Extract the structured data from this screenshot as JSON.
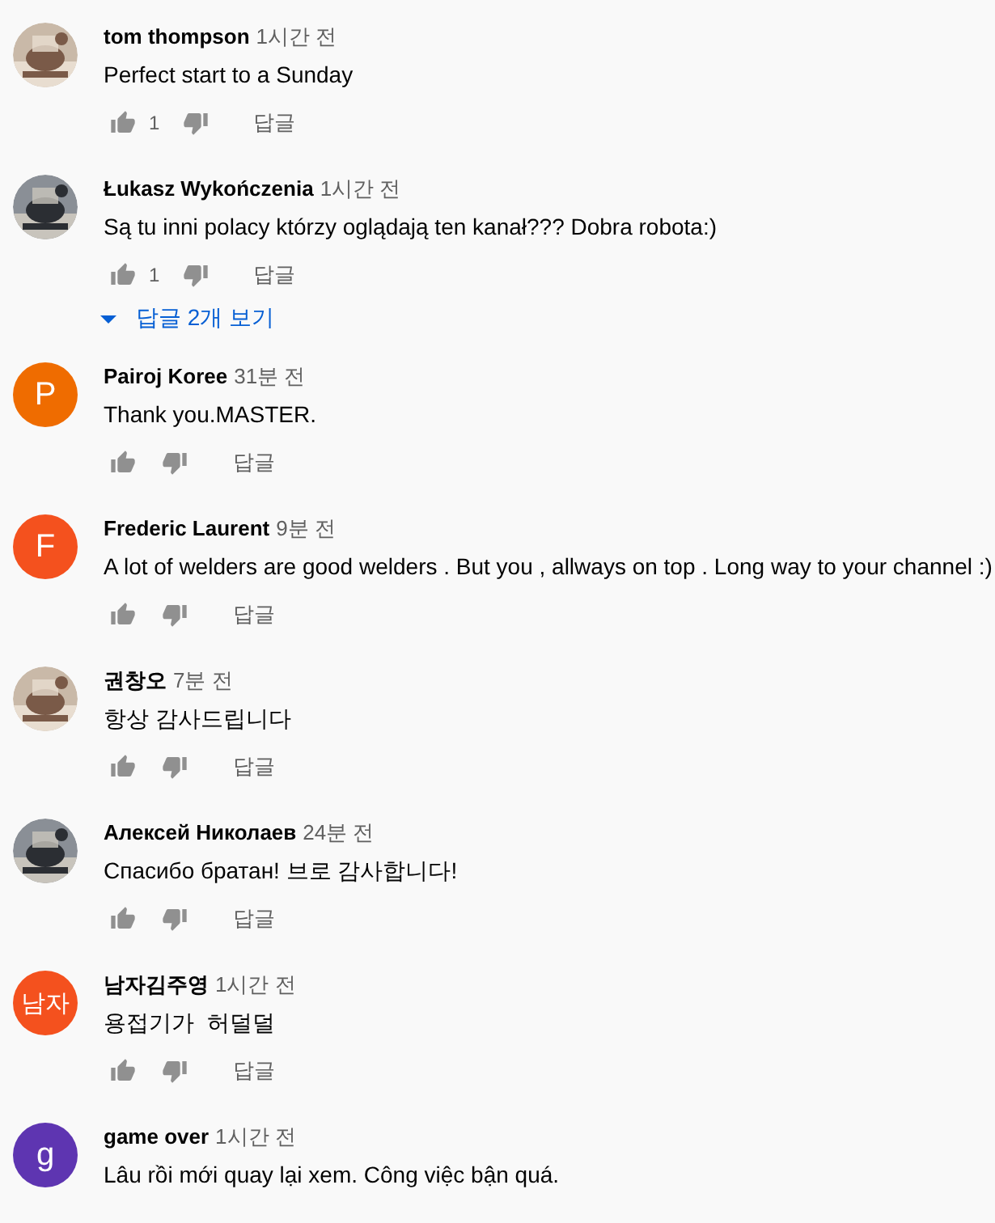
{
  "comments": [
    {
      "author": "tom thompson",
      "time": "1시간 전",
      "text": "Perfect start to a Sunday",
      "likes": "1",
      "reply": "답글"
    },
    {
      "author": "Łukasz Wykończenia",
      "time": "1시간 전",
      "text": "Są tu inni polacy którzy oglądają ten kanał??? Dobra robota:)",
      "likes": "1",
      "reply": "답글",
      "replies_link": "답글 2개 보기"
    },
    {
      "author": "Pairoj Koree",
      "time": "31분 전",
      "text": "Thank you.MASTER.",
      "avatar": {
        "kind": "letter",
        "letter": "P",
        "color": "#ef6c00"
      },
      "reply": "답글"
    },
    {
      "author": "Frederic Laurent",
      "time": "9분 전",
      "text": "A lot of welders are good welders . But you , allways on top . Long way to your channel :)",
      "avatar": {
        "kind": "letter",
        "letter": "F",
        "color": "#f4511e"
      },
      "reply": "답글"
    },
    {
      "author": "권창오",
      "time": "7분 전",
      "text": "항상 감사드립니다",
      "reply": "답글"
    },
    {
      "author": "Алексей Николаев",
      "time": "24분 전",
      "text": "Спасибо братан! 브로 감사합니다!",
      "reply": "답글"
    },
    {
      "author": "남자김주영",
      "time": "1시간 전",
      "text": "용접기가  허덜덜",
      "avatar": {
        "kind": "letter",
        "letter": "남자",
        "color": "#f4511e"
      },
      "reply": "답글"
    },
    {
      "author": "game over",
      "time": "1시간 전",
      "text": "Lâu rồi mới quay lại xem. Công việc bận quá.",
      "avatar": {
        "kind": "letter",
        "letter": "g",
        "color": "#5e35b1"
      }
    }
  ]
}
